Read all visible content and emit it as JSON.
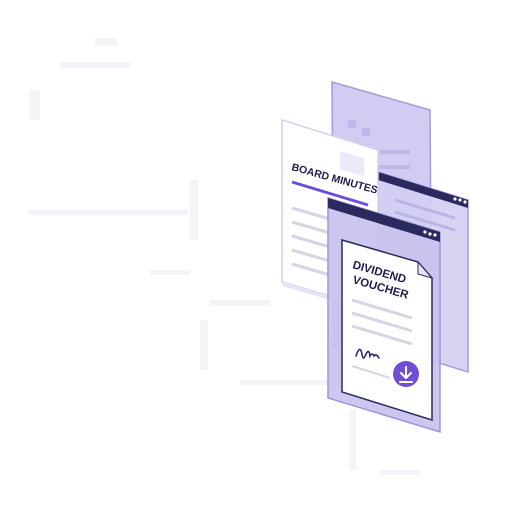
{
  "documents": {
    "board_minutes": {
      "title": "BOARD MINUTES"
    },
    "dividend_voucher": {
      "title_line1": "DIVIDEND",
      "title_line2": "VOUCHER"
    }
  },
  "icons": {
    "download": "download-icon",
    "signature": "signature-icon"
  },
  "colors": {
    "accent": "#6d4fd6",
    "panel_fill": "#cbc6ee",
    "panel_stroke": "#9d95d9",
    "ink": "#1f1b4d",
    "line": "#d3d3e4"
  }
}
